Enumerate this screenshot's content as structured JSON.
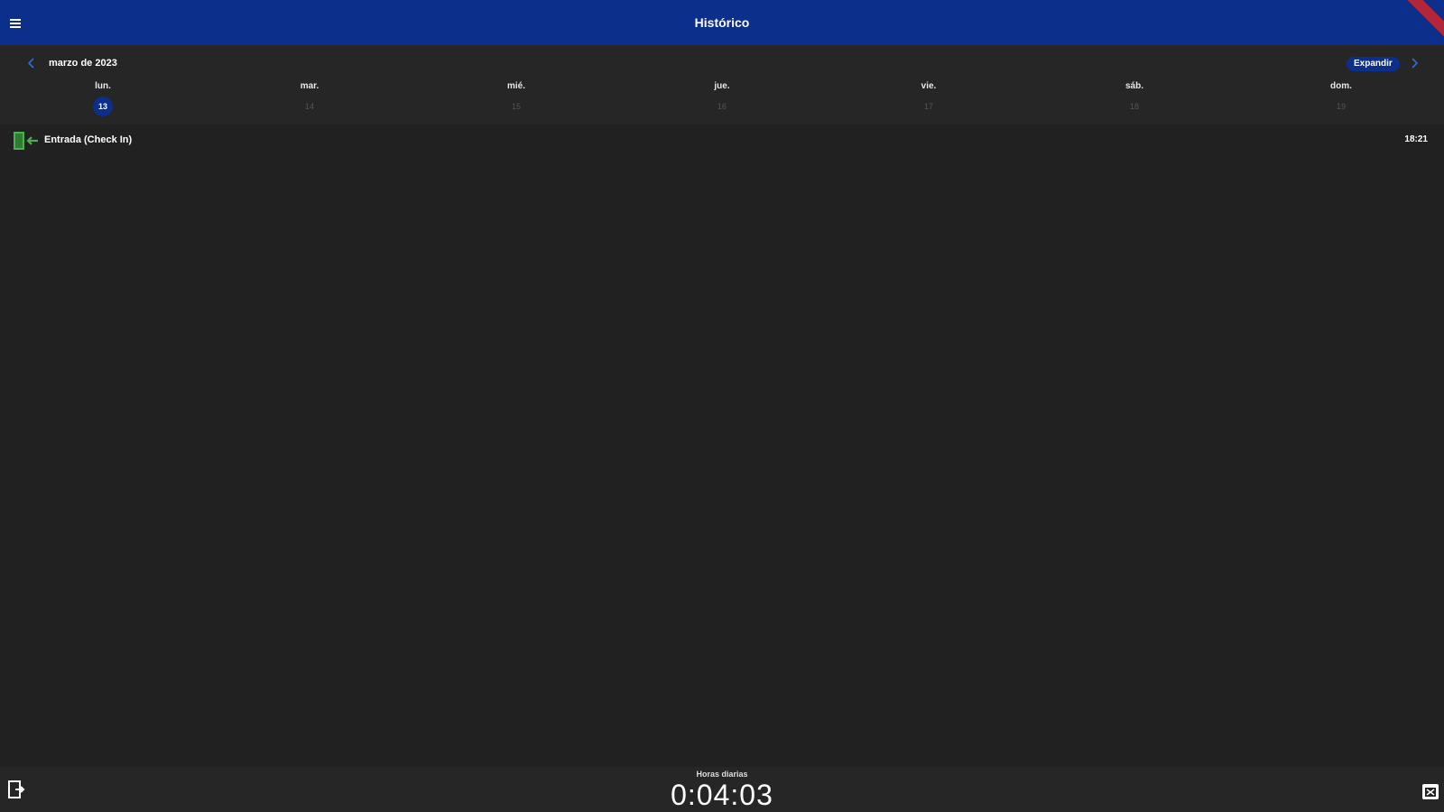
{
  "appbar": {
    "title": "Histórico",
    "menu_icon": "menu-icon",
    "accent_color": "#0d2f8c"
  },
  "calendar": {
    "month_label": "marzo de 2023",
    "expand_label": "Expandir",
    "prev_icon": "chevron-left-icon",
    "next_icon": "chevron-right-icon",
    "days": [
      {
        "name": "lun.",
        "number": "13",
        "selected": true
      },
      {
        "name": "mar.",
        "number": "14",
        "selected": false
      },
      {
        "name": "mié.",
        "number": "15",
        "selected": false
      },
      {
        "name": "jue.",
        "number": "16",
        "selected": false
      },
      {
        "name": "vie.",
        "number": "17",
        "selected": false
      },
      {
        "name": "sáb.",
        "number": "18",
        "selected": false
      },
      {
        "name": "dom.",
        "number": "19",
        "selected": false
      }
    ]
  },
  "entries": [
    {
      "label": "Entrada (Check In)",
      "time": "18:21",
      "icon": "door-enter-icon",
      "icon_color": "#4caf50"
    }
  ],
  "bottombar": {
    "timer_label": "Horas diarias",
    "timer_value": "0:04:03",
    "left_icon": "logout-icon",
    "right_icon": "calendar-grid-icon"
  }
}
